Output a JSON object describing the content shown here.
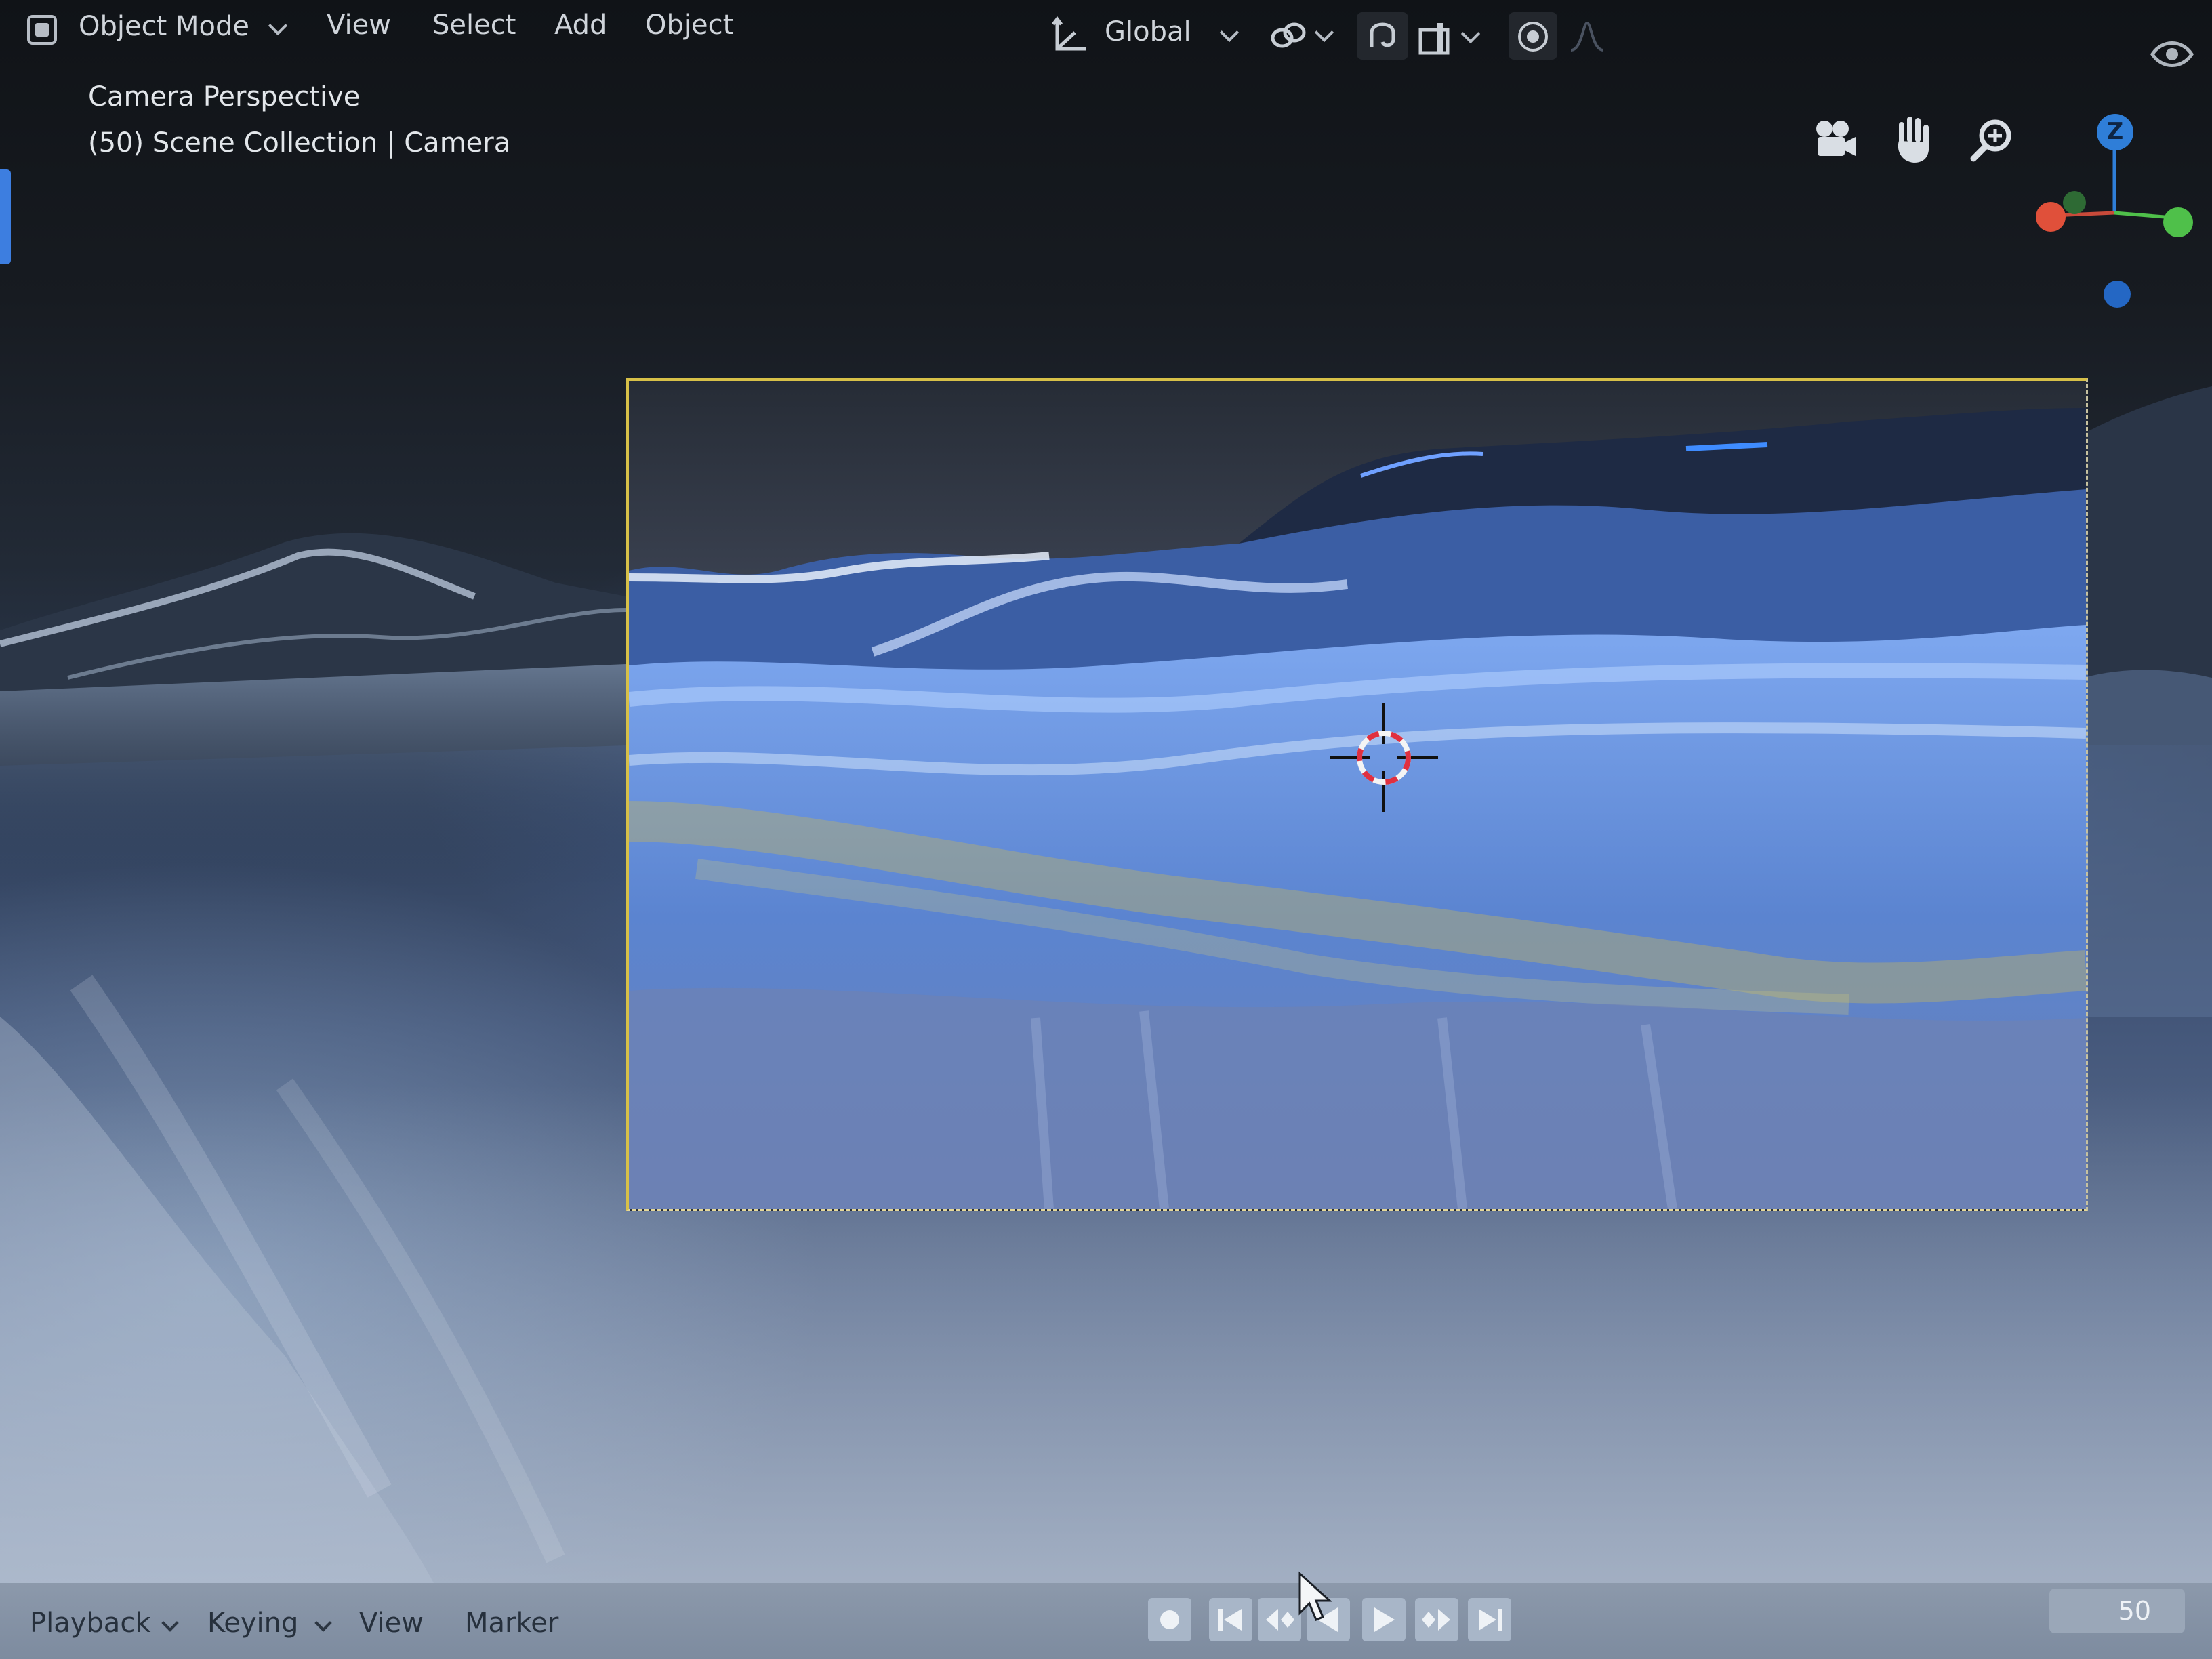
{
  "header": {
    "mode_label": "Object Mode",
    "menus": [
      "View",
      "Select",
      "Add",
      "Object"
    ],
    "orientation_label": "Global",
    "icons": {
      "mode": "object-mode-icon",
      "orientation": "transform-orientation-icon",
      "pivot": "link-icon",
      "snap": "magnet-icon",
      "snap_target": "snap-increment-icon",
      "proportional": "proportional-editing-icon",
      "falloff": "falloff-icon",
      "visibility": "eye-icon"
    }
  },
  "viewport": {
    "perspective_label": "Camera Perspective",
    "collection_label": "(50) Scene Collection | Camera",
    "nav_icons": [
      "camera-view-icon",
      "hand-pan-icon",
      "zoom-icon"
    ],
    "gizmo": {
      "z_label": "Z",
      "colors": {
        "x": "#e0503a",
        "y": "#4fc04a",
        "z": "#2f7ed8"
      }
    },
    "frame_color": "#d7c048"
  },
  "timeline": {
    "menus": [
      "Playback",
      "Keying",
      "View",
      "Marker"
    ],
    "transport_icons": [
      "record-icon",
      "jump-start-icon",
      "prev-keyframe-icon",
      "play-reverse-icon",
      "play-icon",
      "next-keyframe-icon",
      "jump-end-icon"
    ],
    "current_frame": "50"
  }
}
